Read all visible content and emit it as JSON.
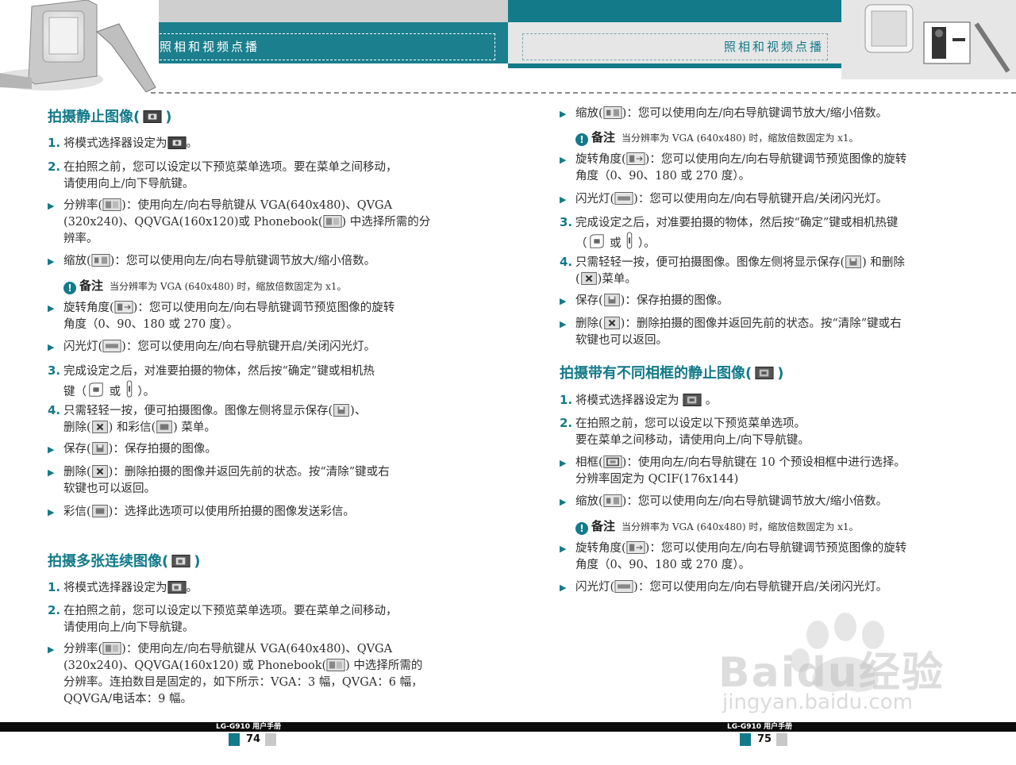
{
  "header": {
    "left_title": "照相和视频点播",
    "right_title": "照相和视频点播"
  },
  "icons": {
    "camera": "camera-mode-icon",
    "multi": "burst-mode-icon",
    "frame": "frame-mode-icon",
    "resolution": "resolution-icon",
    "zoom": "zoom-icon",
    "rotate": "rotate-icon",
    "flash": "flash-icon",
    "save": "save-icon",
    "delete": "delete-icon",
    "mms": "mms-icon",
    "ok_key": "ok-key-icon",
    "side_key": "camera-side-key-icon",
    "note": "note-icon"
  },
  "left": {
    "s1_title": [
      "拍摄静止图像(",
      ")"
    ],
    "l1": [
      "1.",
      "将模式选择器设定为",
      "。"
    ],
    "l2a": [
      "2.",
      "在拍照之前，您可以设定以下预览菜单选项。要在菜单之间移动，"
    ],
    "l2b": "请使用向上/向下导航键。",
    "l3a": [
      "分辨率(",
      ")：使用向左/向右导航键从  VGA(640x480)、QVGA"
    ],
    "l3b": [
      "(320x240)、QQVGA(160x120)或  Phonebook(",
      ")  中选择所需的分"
    ],
    "l3c": "辨率。",
    "l4": [
      "缩放(",
      ")：您可以使用向左/向右导航键调节放大/缩小倍数。"
    ],
    "note1": [
      "备注",
      "当分辨率为  VGA  (640x480)  时，缩放倍数固定为  x1。"
    ],
    "l5a": [
      "旋转角度(",
      ")：您可以使用向左/向右导航键调节预览图像的旋转"
    ],
    "l5b": "角度（0、90、180  或  270  度）。",
    "l6": [
      "闪光灯(",
      ")：您可以使用向左/向右导航键开启/关闭闪光灯。"
    ],
    "l7a": [
      "3.",
      "完成设定之后，对准要拍摄的物体，然后按“确定”键或相机热"
    ],
    "l7b": [
      "键（",
      "或",
      "）。"
    ],
    "l8a": [
      "4.",
      "只需轻轻一按，便可拍摄图像。图像左侧将显示保存(",
      ")、"
    ],
    "l8b": [
      "删除(",
      ")  和彩信(",
      ")  菜单。"
    ],
    "l9": [
      "保存(",
      ")：保存拍摄的图像。"
    ],
    "l10a": [
      "删除(",
      ")：删除拍摄的图像并返回先前的状态。按“清除”键或右"
    ],
    "l10b": "软键也可以返回。",
    "l11": [
      "彩信(",
      ")：选择此选项可以使用所拍摄的图像发送彩信。"
    ],
    "s2_title": [
      "拍摄多张连续图像(",
      ")"
    ],
    "m1": [
      "1.",
      "将模式选择器设定为",
      "。"
    ],
    "m2a": [
      "2.",
      "在拍照之前，您可以设定以下预览菜单选项。要在菜单之间移动，"
    ],
    "m2b": "请使用向上/向下导航键。",
    "m3a": [
      "分辨率(",
      ")：使用向左/向右导航键从  VGA(640x480)、QVGA"
    ],
    "m3b": [
      "(320x240)、QQVGA(160x120)  或  Phonebook(",
      ")  中选择所需的"
    ],
    "m3c": "分辨率。连拍数目是固定的，如下所示：VGA：3  幅，QVGA：6  幅，",
    "m3d": "QQVGA/电话本：9  幅。"
  },
  "right": {
    "r1": [
      "缩放(",
      ")：您可以使用向左/向右导航键调节放大/缩小倍数。"
    ],
    "note1": [
      "备注",
      "当分辨率为  VGA  (640x480)  时，缩放倍数固定为  x1。"
    ],
    "r2a": [
      "旋转角度(",
      ")：您可以使用向左/向右导航键调节预览图像的旋转"
    ],
    "r2b": "角度（0、90、180  或  270  度）。",
    "r3": [
      "闪光灯(",
      ")：您可以使用向左/向右导航键开启/关闭闪光灯。"
    ],
    "r4a": [
      "3.",
      "完成设定之后，对准要拍摄的物体，然后按“确定”键或相机热键"
    ],
    "r4b": [
      "（",
      "或",
      "）。"
    ],
    "r5a": [
      "4.",
      "只需轻轻一按，便可拍摄图像。图像左侧将显示保存(",
      ")  和删除"
    ],
    "r5b": [
      "(",
      ")菜单。"
    ],
    "r6": [
      "保存(",
      ")：保存拍摄的图像。"
    ],
    "r7a": [
      "删除(",
      ")：删除拍摄的图像并返回先前的状态。按“清除”键或右"
    ],
    "r7b": "软键也可以返回。",
    "s3_title": [
      "拍摄带有不同相框的静止图像(",
      ")"
    ],
    "f1": [
      "1.",
      "将模式选择器设定为",
      "。"
    ],
    "f2a": [
      "2.",
      "在拍照之前，您可以设定以下预览菜单选项。"
    ],
    "f2b": "要在菜单之间移动，请使用向上/向下导航键。",
    "f3a": [
      "相框(",
      ")：使用向左/向右导航键在  10  个预设相框中进行选择。"
    ],
    "f3b": "分辨率固定为  QCIF(176x144)",
    "f4": [
      "缩放(",
      ")：您可以使用向左/向右导航键调节放大/缩小倍数。"
    ],
    "note2": [
      "备注",
      "当分辨率为  VGA  (640x480)  时，缩放倍数固定为  x1。"
    ],
    "f5a": [
      "旋转角度(",
      ")：您可以使用向左/向右导航键调节预览图像的旋转"
    ],
    "f5b": "角度（0、90、180  或  270  度）。",
    "f6": [
      "闪光灯(",
      ")：您可以使用向左/向右导航键开启/关闭闪光灯。"
    ]
  },
  "footer": {
    "left_label": "LG-G910 用户手册",
    "left_page": "74",
    "right_label": "LG-G910 用户手册",
    "right_page": "75"
  },
  "watermark": {
    "brand_a": "Bai",
    "brand_b": "du",
    "brand_c": "经验",
    "url": "jingyan.baidu.com"
  },
  "colors": {
    "teal": "#137a89",
    "header_gray": "#cfcfcf",
    "footer_black": "#0c0c0c"
  }
}
